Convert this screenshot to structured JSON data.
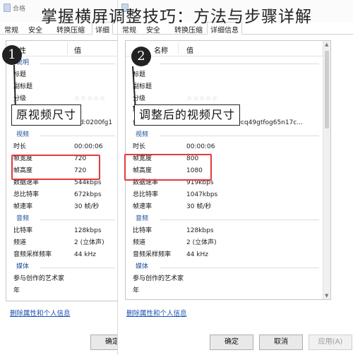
{
  "banner": {
    "title": "掌握横屏调整技巧：方法与步骤详解"
  },
  "left": {
    "titlebar_text": "合格",
    "tabs": [
      "常规",
      "安全",
      "转换压缩",
      "详细"
    ],
    "col_name": "性",
    "col_value": "值",
    "rows": [
      {
        "type": "section",
        "k": "说明",
        "v": ""
      },
      {
        "type": "item",
        "k": "标题",
        "v": ""
      },
      {
        "type": "item",
        "k": "副标题",
        "v": ""
      },
      {
        "type": "stars",
        "k": "分级",
        "v": "☆☆☆☆☆"
      },
      {
        "type": "item",
        "k": "标记",
        "v": ""
      },
      {
        "type": "item",
        "k": "备注",
        "v": "vid:0200fg1"
      },
      {
        "type": "section",
        "k": "视频",
        "v": ""
      },
      {
        "type": "item",
        "k": "时长",
        "v": "00:00:06"
      },
      {
        "type": "item",
        "k": "帧宽度",
        "v": "720"
      },
      {
        "type": "item",
        "k": "帧高度",
        "v": "720"
      },
      {
        "type": "item",
        "k": "数据速率",
        "v": "544kbps"
      },
      {
        "type": "item",
        "k": "总比特率",
        "v": "672kbps"
      },
      {
        "type": "item",
        "k": "帧速率",
        "v": "30 帧/秒"
      },
      {
        "type": "section",
        "k": "音频",
        "v": ""
      },
      {
        "type": "item",
        "k": "比特率",
        "v": "128kbps"
      },
      {
        "type": "item",
        "k": "频道",
        "v": "2 (立体声)"
      },
      {
        "type": "item",
        "k": "音频采样频率",
        "v": "44 kHz"
      },
      {
        "type": "section",
        "k": "媒体",
        "v": ""
      },
      {
        "type": "item",
        "k": "参与创作的艺术家",
        "v": ""
      },
      {
        "type": "item",
        "k": "年",
        "v": ""
      }
    ],
    "remove_link": "删除属性和个人信息",
    "ok_button": "确定",
    "badge": "1",
    "callout": "原视频尺寸"
  },
  "right": {
    "titlebar_text": "",
    "tabs": [
      "常规",
      "安全",
      "转换压缩",
      "详细信息"
    ],
    "col_name": "名称",
    "col_value": "值",
    "rows": [
      {
        "type": "section",
        "k": "说明",
        "v": ""
      },
      {
        "type": "item",
        "k": "标题",
        "v": ""
      },
      {
        "type": "item",
        "k": "副标题",
        "v": ""
      },
      {
        "type": "stars",
        "k": "分级",
        "v": "☆☆☆☆☆"
      },
      {
        "type": "item",
        "k": "标记",
        "v": ""
      },
      {
        "type": "item",
        "k": "备注",
        "v": "vid:0200fg10000cq49gtfog65n17c..."
      },
      {
        "type": "section",
        "k": "视频",
        "v": ""
      },
      {
        "type": "item",
        "k": "时长",
        "v": "00:00:06"
      },
      {
        "type": "item",
        "k": "帧宽度",
        "v": "800"
      },
      {
        "type": "item",
        "k": "帧高度",
        "v": "1080"
      },
      {
        "type": "item",
        "k": "数据速率",
        "v": "919kbps"
      },
      {
        "type": "item",
        "k": "总比特率",
        "v": "1047kbps"
      },
      {
        "type": "item",
        "k": "帧速率",
        "v": "30 帧/秒"
      },
      {
        "type": "section",
        "k": "音频",
        "v": ""
      },
      {
        "type": "item",
        "k": "比特率",
        "v": "128kbps"
      },
      {
        "type": "item",
        "k": "频道",
        "v": "2 (立体声)"
      },
      {
        "type": "item",
        "k": "音频采样频率",
        "v": "44 kHz"
      },
      {
        "type": "section",
        "k": "媒体",
        "v": ""
      },
      {
        "type": "item",
        "k": "参与创作的艺术家",
        "v": ""
      },
      {
        "type": "item",
        "k": "年",
        "v": ""
      }
    ],
    "remove_link": "删除属性和个人信息",
    "ok_button": "确定",
    "cancel_button": "取消",
    "apply_button": "应用(A)",
    "badge": "2",
    "callout": "调整后的视频尺寸"
  }
}
